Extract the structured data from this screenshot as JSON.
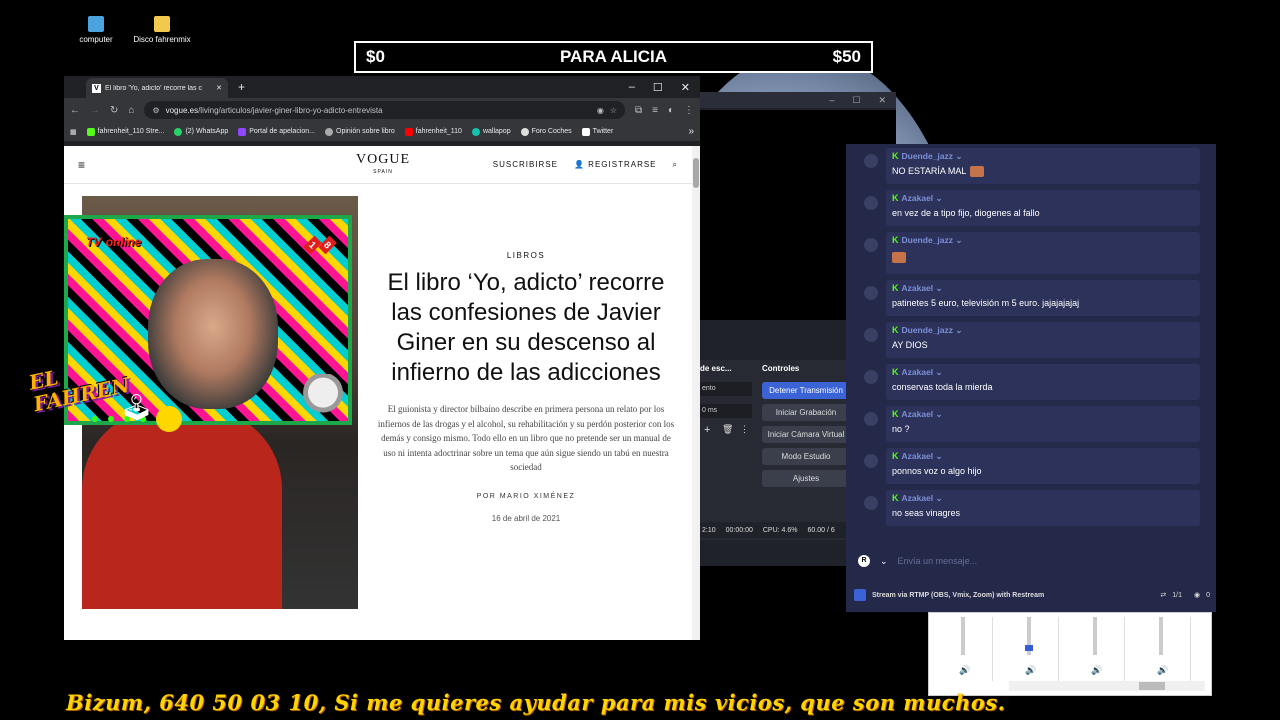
{
  "desktop": {
    "icons": [
      {
        "label": "computer",
        "icon": "computer-icon"
      },
      {
        "label": "Disco fahrenmix",
        "icon": "folder-icon"
      }
    ]
  },
  "banner": {
    "left": "$0",
    "title": "PARA ALICIA",
    "right": "$50"
  },
  "browser": {
    "tab_title": "El libro 'Yo, adicto' recorre las c",
    "tab_favicon": "V",
    "new_tab": "+",
    "window_controls": {
      "minimize": "–",
      "maximize": "☐",
      "close": "✕"
    },
    "url_domain": "vogue.es",
    "url_path": "/living/articulos/javier-giner-libro-yo-adicto-entrevista",
    "bookmarks": [
      {
        "label": "fahrenheit_110 Stre...",
        "color": "#53fc18"
      },
      {
        "label": "(2) WhatsApp",
        "color": "#25d366"
      },
      {
        "label": "Portal de apelacion...",
        "color": "#9146ff"
      },
      {
        "label": "Opinión sobre libro",
        "color": "#aaaaaa"
      },
      {
        "label": "fahrenheit_110",
        "color": "#ff0000"
      },
      {
        "label": "wallapop",
        "color": "#13c1ac"
      },
      {
        "label": "Foro Coches",
        "color": "#dddddd"
      },
      {
        "label": "Twitter",
        "color": "#ffffff"
      }
    ],
    "bookmarks_more": "»"
  },
  "vogue": {
    "logo": "VOGUE",
    "logo_sub": "SPAIN",
    "subscribe": "SUSCRIBIRSE",
    "register": "REGISTRARSE",
    "category": "LIBROS",
    "headline": "El libro ‘Yo, adicto’ recorre las confesiones de Javier Giner en su descenso al infierno de las adicciones",
    "lede": "El guionista y director bilbaíno describe en primera persona un relato por los infiernos de las drogas y el alcohol, su rehabilitación y su perdón posterior con los demás y consigo mismo. Todo ello en un libro que no pretende ser un manual de uso ni intenta adoctrinar sobre un tema que aún sigue siendo un tabú en nuestra sociedad",
    "byline": "POR MARIO XIMÉNEZ",
    "date": "16 de abril de 2021"
  },
  "cam_overlay": {
    "tv_label": "TV",
    "tv_label2": "online",
    "age_1": "1",
    "age_2": "8",
    "brand_line1": "EL",
    "brand_line2": "FAHREN"
  },
  "obs": {
    "scenes_header": "de esc...",
    "controls_header": "Controles",
    "dropdown_value": "ento",
    "delay_value": "0 ms",
    "buttons": [
      {
        "label": "Detener Transmisión",
        "active": true
      },
      {
        "label": "Iniciar Grabación",
        "active": false
      },
      {
        "label": "Iniciar Cámara Virtual",
        "active": false
      },
      {
        "label": "Modo Estudio",
        "active": false
      },
      {
        "label": "Ajustes",
        "active": false
      }
    ],
    "status": {
      "time1": "2:10",
      "time2": "00:00:00",
      "cpu": "CPU: 4.6%",
      "fps": "60.00 / 6"
    }
  },
  "chat": {
    "messages": [
      {
        "user": "Duende_jazz",
        "text": "NO ESTARÍA MAL",
        "emote": true
      },
      {
        "user": "Azakael",
        "text": "en vez de a tipo fijo, diogenes al fallo",
        "emote": false
      },
      {
        "user": "Duende_jazz",
        "text": "",
        "emote": true
      },
      {
        "user": "Azakael",
        "text": "patinetes 5 euro, televisión m 5 euro. jajajajajaj",
        "emote": false
      },
      {
        "user": "Duende_jazz",
        "text": "AY DIOS",
        "emote": false
      },
      {
        "user": "Azakael",
        "text": "conservas toda la mierda",
        "emote": false
      },
      {
        "user": "Azakael",
        "text": "no ?",
        "emote": false
      },
      {
        "user": "Azakael",
        "text": "ponnos voz o algo hijo",
        "emote": false
      },
      {
        "user": "Azakael",
        "text": "no seas vinagres",
        "emote": false
      }
    ],
    "input_placeholder": "Envía un mensaje...",
    "stream_source": "Stream via RTMP (OBS, Vmix, Zoom) with Restream",
    "dest_count": "1/1",
    "viewers": "0"
  },
  "ticker": "Bizum, 640 50 03 10,  Si me quieres ayudar para mis vicios, que son muchos."
}
